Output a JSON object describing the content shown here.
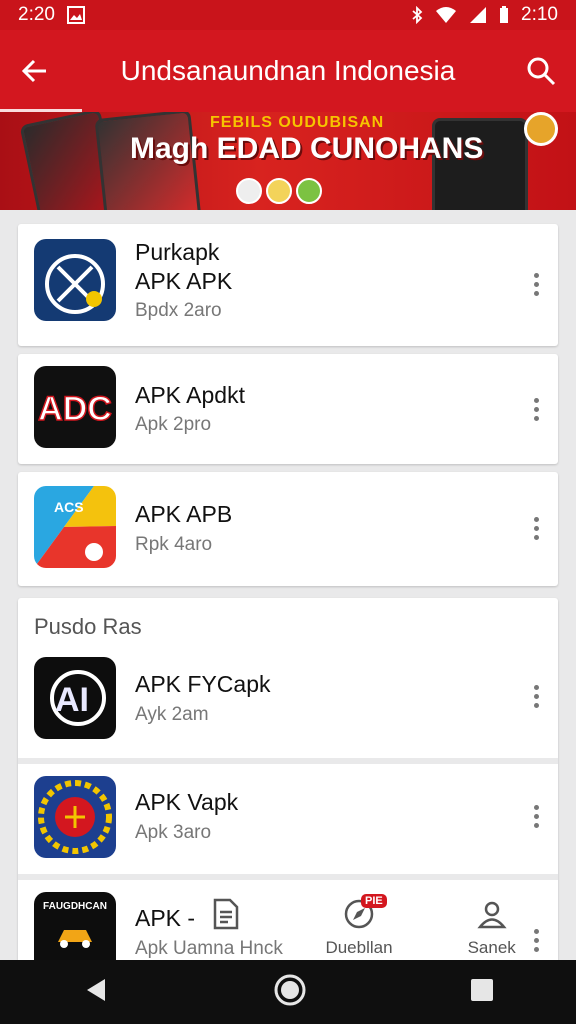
{
  "status_bar": {
    "time_left": "2:20",
    "time_right": "2:10"
  },
  "app_bar": {
    "title": "Undsanaundnan Indonesia"
  },
  "banner": {
    "tagline": "FEBILS OUDUBISAN",
    "headline": "Magh EDAD CUNOHANS"
  },
  "apps_top": [
    {
      "name_line1": "Purkapk",
      "name_line2": "APK APK",
      "sub": "Bpdx 2aro"
    },
    {
      "name_line1": "APK Apdkt",
      "name_line2": "",
      "sub": "Apk 2pro"
    },
    {
      "name_line1": "APK APB",
      "name_line2": "",
      "sub": "Rpk 4aro"
    }
  ],
  "section": {
    "title": "Pusdo Ras",
    "apps": [
      {
        "name": "APK FYCapk",
        "sub": "Ayk 2am"
      },
      {
        "name": "APK Vapk",
        "sub": "Apk 3aro"
      },
      {
        "name": "APK -",
        "sub": "Apk Uamna Hnck",
        "icon_label": "FAUGDHCAN"
      }
    ]
  },
  "bottom_tabs": [
    {
      "label": "",
      "icon": "document-icon"
    },
    {
      "label": "Duebllan",
      "icon": "compass-icon",
      "badge": "PIE"
    },
    {
      "label": "Sanek",
      "icon": "person-icon"
    }
  ],
  "icons": {
    "back": "arrow-left-icon",
    "search": "search-icon",
    "nav_back": "triangle-back-icon",
    "nav_home": "home-circle-icon",
    "nav_recents": "square-recents-icon"
  },
  "colors": {
    "primary": "#d3171f",
    "status": "#c9141b",
    "nav": "#0f0f0f"
  }
}
